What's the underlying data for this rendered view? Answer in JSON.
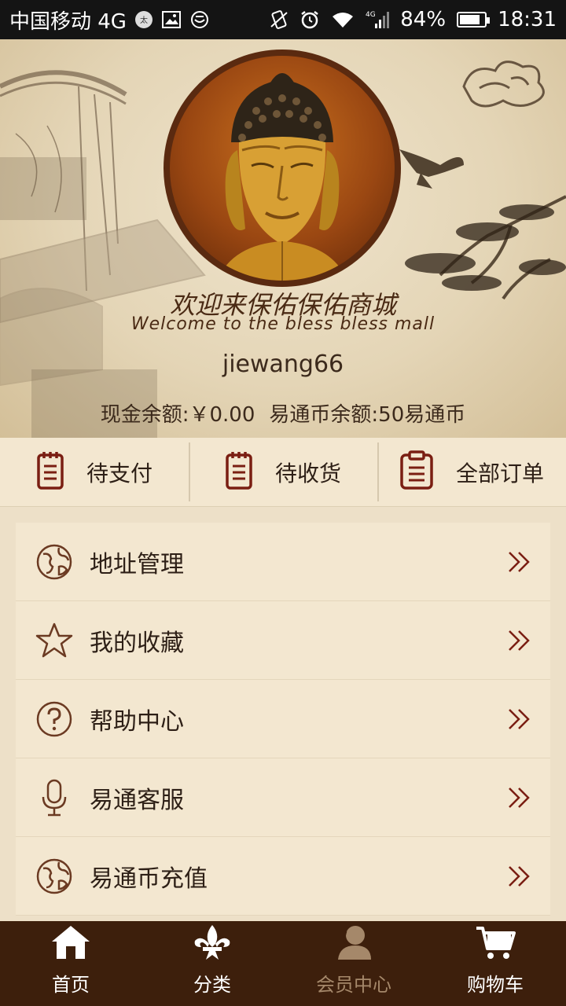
{
  "status_bar": {
    "carrier": "中国移动 4G",
    "battery": "84%",
    "battery_level": 0.84,
    "time": "18:31"
  },
  "profile": {
    "welcome_cn": "欢迎来保佑保佑商城",
    "welcome_en": "Welcome to the bless bless mall",
    "username": "jiewang66",
    "cash_balance": "现金余额:￥0.00",
    "coin_balance": "易通币余额:50易通币"
  },
  "orders": [
    {
      "label": "待支付",
      "icon": "notepad-icon"
    },
    {
      "label": "待收货",
      "icon": "notepad-icon"
    },
    {
      "label": "全部订单",
      "icon": "clipboard-icon"
    }
  ],
  "menu": [
    {
      "label": "地址管理",
      "icon": "globe-icon"
    },
    {
      "label": "我的收藏",
      "icon": "star-icon"
    },
    {
      "label": "帮助中心",
      "icon": "help-icon"
    },
    {
      "label": "易通客服",
      "icon": "microphone-icon"
    },
    {
      "label": "易通币充值",
      "icon": "globe-icon"
    }
  ],
  "tabs": [
    {
      "label": "首页",
      "icon": "home-icon"
    },
    {
      "label": "分类",
      "icon": "fleur-de-lis-icon"
    },
    {
      "label": "会员中心",
      "icon": "member-icon",
      "active": true
    },
    {
      "label": "购物车",
      "icon": "cart-icon"
    }
  ],
  "colors": {
    "brown_dark": "#3d1f0c",
    "accent": "#7a1e12",
    "cream": "#f3e7d0",
    "tab_active": "#a5886a"
  }
}
